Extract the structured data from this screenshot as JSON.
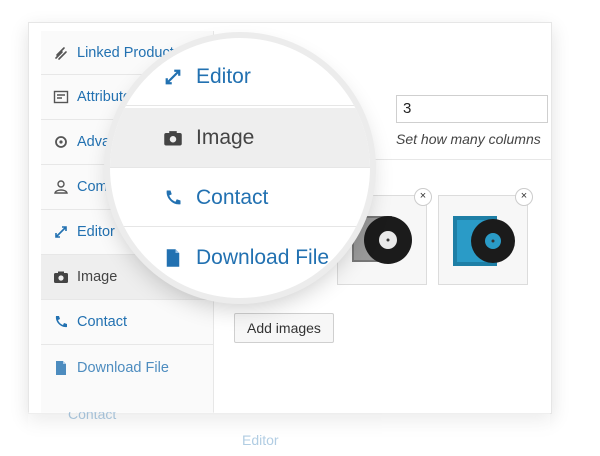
{
  "sidebar": {
    "items": [
      {
        "label": "Linked Products",
        "icon": "link-icon",
        "active": false
      },
      {
        "label": "Attributes",
        "icon": "list-icon",
        "active": false
      },
      {
        "label": "Advanced",
        "icon": "gear-icon",
        "active": false
      },
      {
        "label": "Comments",
        "icon": "user-icon",
        "active": false
      },
      {
        "label": "Editor",
        "icon": "expand-icon",
        "active": false
      },
      {
        "label": "Image",
        "icon": "camera-icon",
        "active": true
      },
      {
        "label": "Contact",
        "icon": "phone-icon",
        "active": false
      },
      {
        "label": "Download File",
        "icon": "file-icon",
        "active": false
      }
    ]
  },
  "magnifier": {
    "items": [
      {
        "label": "Editor",
        "icon": "expand-icon",
        "active": false
      },
      {
        "label": "Image",
        "icon": "camera-icon",
        "active": true
      },
      {
        "label": "Contact",
        "icon": "phone-icon",
        "active": false
      },
      {
        "label": "Download File",
        "icon": "file-icon",
        "active": false
      }
    ]
  },
  "content": {
    "columns_value": "3",
    "columns_hint": "Set how many columns",
    "add_images_label": "Add images",
    "close_glyph": "×"
  },
  "reflection": {
    "contact": "Contact",
    "editor": "Editor"
  },
  "colors": {
    "link": "#2271b1",
    "active_tab": "#eeeeee"
  }
}
